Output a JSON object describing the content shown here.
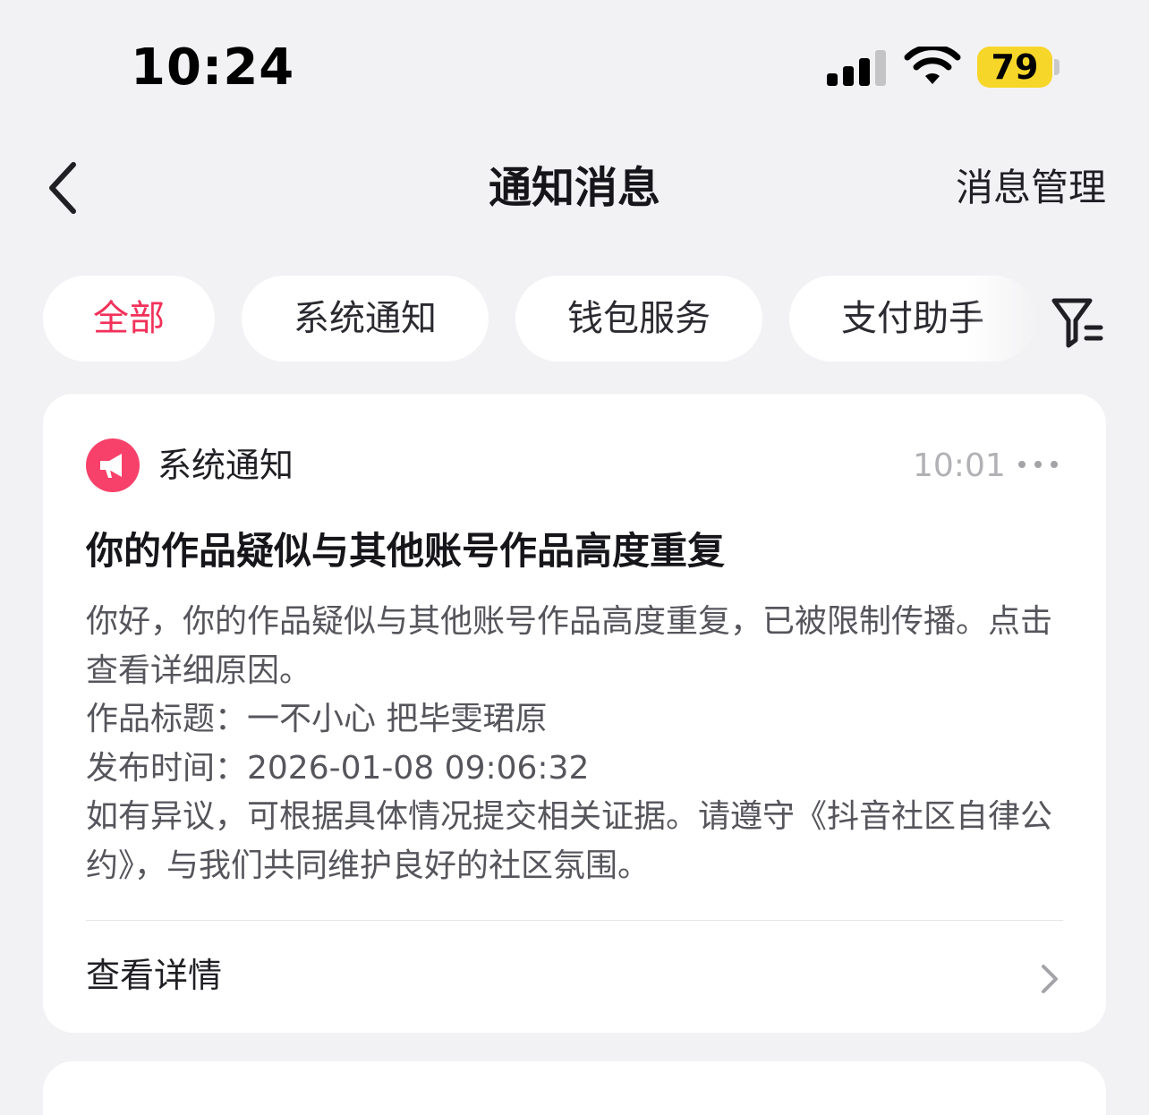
{
  "status_bar": {
    "time": "10:24",
    "battery": "79",
    "battery_color": "#f7d62a"
  },
  "nav": {
    "title": "通知消息",
    "manage_label": "消息管理",
    "back_icon": "chevron-left-icon"
  },
  "tabs": [
    {
      "label": "全部",
      "active": true
    },
    {
      "label": "系统通知",
      "active": false
    },
    {
      "label": "钱包服务",
      "active": false
    },
    {
      "label": "支付助手",
      "active": false
    }
  ],
  "filter_icon": "filter-icon",
  "notification": {
    "source": "系统通知",
    "source_icon": "megaphone-icon",
    "time": "10:01",
    "title": "你的作品疑似与其他账号作品高度重复",
    "body_lines": [
      "你好，你的作品疑似与其他账号作品高度重复，已被限制传播。点击查看详细原因。",
      "作品标题：一不小心 把毕雯珺原",
      "发布时间：2026-01-08 09:06:32",
      "如有异议，可根据具体情况提交相关证据。请遵守《抖音社区自律公约》，与我们共同维护良好的社区氛围。"
    ],
    "detail_label": "查看详情"
  },
  "colors": {
    "accent": "#f2315a",
    "icon_bg": "#f7416a",
    "page_bg": "#f2f2f4"
  }
}
